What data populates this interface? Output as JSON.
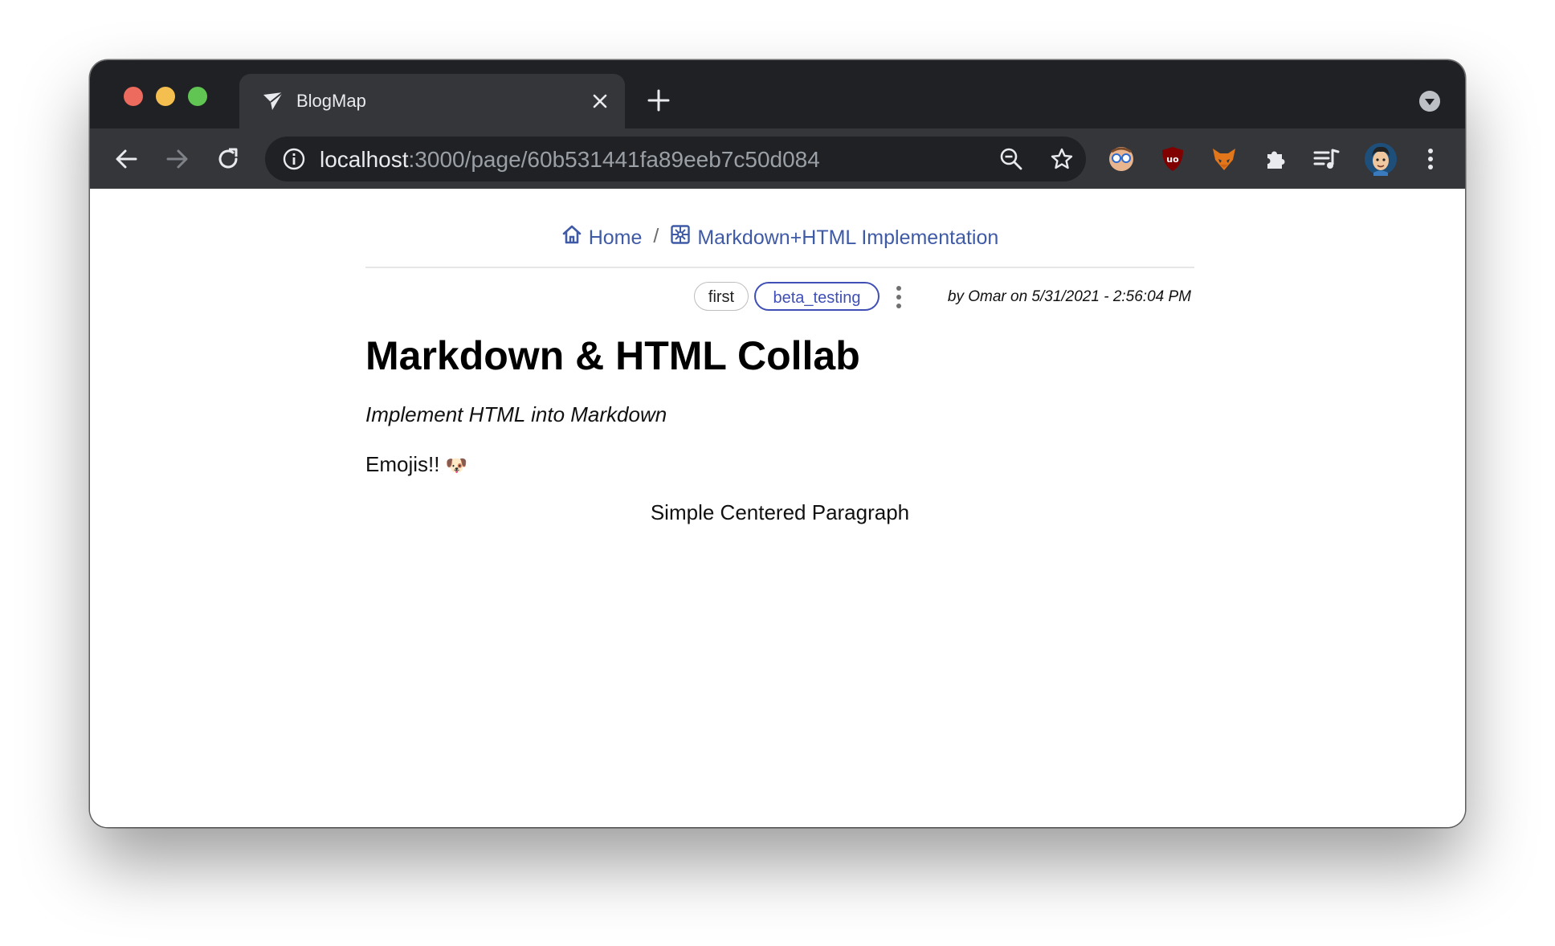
{
  "browser": {
    "tab": {
      "title": "BlogMap"
    },
    "address": {
      "host": "localhost",
      "path": ":3000/page/60b531441fa89eeb7c50d084"
    }
  },
  "page": {
    "breadcrumb": [
      {
        "label": "Home",
        "icon": "home-icon"
      },
      {
        "label": "Markdown+HTML Implementation",
        "icon": "map-icon"
      }
    ],
    "breadcrumb_separator": "/",
    "tags": [
      "first",
      "beta_testing"
    ],
    "byline": "by Omar on 5/31/2021 - 2:56:04 PM",
    "title": "Markdown & HTML Collab",
    "subtitle": "Implement HTML into Markdown",
    "emoji_text": "Emojis!!",
    "emoji": "🐶",
    "centered_paragraph": "Simple Centered Paragraph"
  },
  "colors": {
    "link": "#3f5aa6",
    "tag_accent": "#3f4fb5",
    "chrome_dark": "#202124",
    "chrome_toolbar": "#35363a"
  }
}
